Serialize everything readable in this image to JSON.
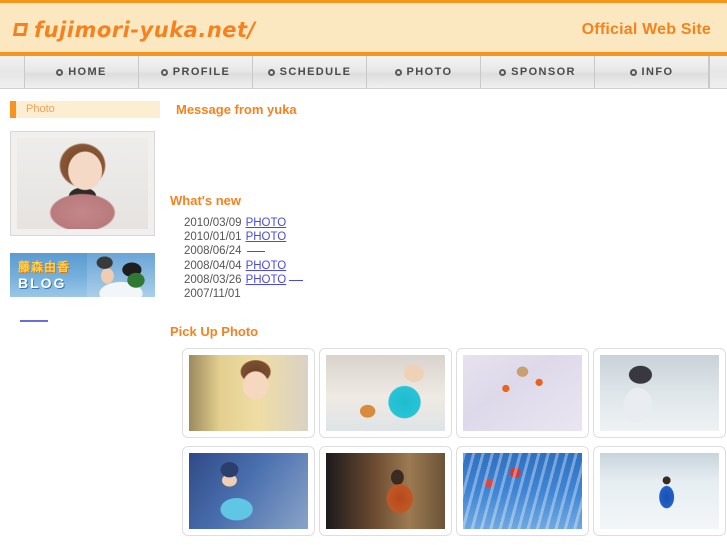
{
  "header": {
    "logo_text": "fujimori-yuka.net/",
    "logo_icon": "square-outline-icon",
    "tagline": "Official Web Site"
  },
  "nav": {
    "items": [
      {
        "label": "HOME"
      },
      {
        "label": "PROFILE"
      },
      {
        "label": "SCHEDULE"
      },
      {
        "label": "PHOTO"
      },
      {
        "label": "SPONSOR"
      },
      {
        "label": "INFO"
      }
    ]
  },
  "breadcrumb": {
    "label": "Photo"
  },
  "page": {
    "title": "Message from yuka"
  },
  "sidebar": {
    "profile_photo_alt": "profile-portrait",
    "blog_banner": {
      "name_jp": "藤森由香",
      "label_en": "BLOG"
    },
    "under_link_label": ""
  },
  "whats_new": {
    "title": "What's new",
    "entries": [
      {
        "date": "2010/03/09",
        "link": "PHOTO",
        "extra": null
      },
      {
        "date": "2010/01/01",
        "link": "PHOTO",
        "extra": null
      },
      {
        "date": "2008/06/24",
        "link": "",
        "extra": null
      },
      {
        "date": "2008/04/04",
        "link": "PHOTO",
        "extra": null
      },
      {
        "date": "2008/03/26",
        "link": "PHOTO",
        "extra": ""
      },
      {
        "date": "2007/11/01",
        "link": null,
        "extra": null
      }
    ]
  },
  "pickup": {
    "title": "Pick Up Photo",
    "photos": [
      {
        "id": "photo-1",
        "alt": "woman-drinking-with-straw"
      },
      {
        "id": "photo-2",
        "alt": "snowboarder-waving-with-cat"
      },
      {
        "id": "photo-3",
        "alt": "skier-in-powder-snow"
      },
      {
        "id": "photo-4",
        "alt": "athlete-back-view-at-course"
      },
      {
        "id": "photo-5",
        "alt": "olympic-athlete-with-board"
      },
      {
        "id": "photo-6",
        "alt": "woman-in-orange-coat-indoors"
      },
      {
        "id": "photo-7",
        "alt": "spectators-on-blue-stands"
      },
      {
        "id": "photo-8",
        "alt": "athlete-in-blue-jacket-on-snow"
      }
    ]
  },
  "colors": {
    "brand_orange": "#f5821f",
    "header_bg": "#fbe8c0",
    "link_blue": "#4a4ae0",
    "crumb_bg": "#fceed1"
  }
}
